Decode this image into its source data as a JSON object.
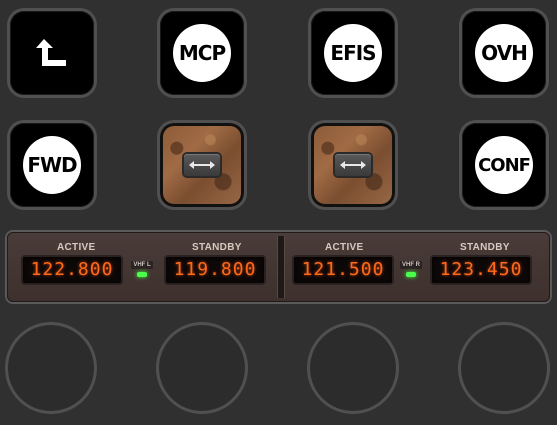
{
  "keys": {
    "back": {
      "icon": "return-arrow-icon"
    },
    "mcp": {
      "label": "MCP"
    },
    "efis": {
      "label": "EFIS"
    },
    "ovh": {
      "label": "OVH"
    },
    "fwd": {
      "label": "FWD"
    },
    "slider1": {
      "icon": "horizontal-arrows-icon"
    },
    "slider2": {
      "icon": "horizontal-arrows-icon"
    },
    "conf": {
      "label": "CONF"
    }
  },
  "radio": {
    "left": {
      "active_label": "ACTIVE",
      "active_freq": "122.800",
      "standby_label": "STANDBY",
      "standby_freq": "119.800",
      "indicator": "VHF L"
    },
    "right": {
      "active_label": "ACTIVE",
      "active_freq": "121.500",
      "standby_label": "STANDBY",
      "standby_freq": "123.450",
      "indicator": "VHF R"
    }
  },
  "colors": {
    "background": "#303030",
    "display_text": "#ff6a1a",
    "led": "#4cff4c"
  }
}
